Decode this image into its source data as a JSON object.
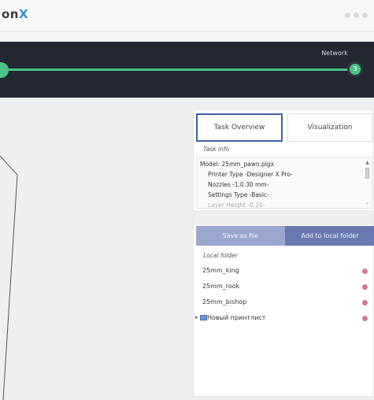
{
  "app": {
    "logo_text": "on",
    "logo_mark": "X"
  },
  "progress": {
    "step_label": "Network",
    "step_number": "3"
  },
  "panel": {
    "tabs": [
      {
        "label": "Task Overview",
        "active": true
      },
      {
        "label": "Visualization",
        "active": false
      }
    ],
    "task_info_label": "Task info",
    "task_info_lines": [
      "Model: 25mm_pawn.plgx",
      "Printer Type -Designer X Pro-",
      "Nozzles -1.0.30 mm-",
      "Settings Type -Basic-",
      "Layer Height -0.20-"
    ],
    "save_button": "Save as file",
    "add_local_button": "Add to local folder",
    "local_folder_label": "Local folder",
    "folders": [
      {
        "name": "25mm_king"
      },
      {
        "name": "25mm_rook"
      },
      {
        "name": "25mm_bishop"
      },
      {
        "name": "Новый принтлист"
      }
    ]
  },
  "colors": {
    "accent_green": "#4cc389",
    "header_dark": "#232833",
    "button_light": "#9aa7cf",
    "button_dark": "#6a7ab1",
    "delete_dot": "#d27b86"
  }
}
